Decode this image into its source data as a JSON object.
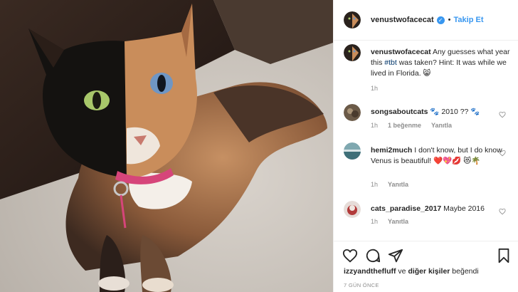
{
  "post": {
    "username": "venustwofacecat",
    "separator": "•",
    "follow_label": "Takip Et",
    "verified_glyph": "✓"
  },
  "caption": {
    "username": "venustwofacecat",
    "text_before_tag": " Any guesses what year this ",
    "hashtag": "#tbt",
    "text_after_tag": " was taken? Hint: It was while we lived in Florida. 😸",
    "time": "1h"
  },
  "comments": [
    {
      "username": "songsaboutcats",
      "text": " 🐾 2010 ?? 🐾",
      "time": "1h",
      "likes": "1 beğenme",
      "reply": "Yanıtla"
    },
    {
      "username": "hemi2much",
      "text": " I don't know, but I do know Venus is beautiful! ❤️💖💋 😻🌴",
      "time": "1h",
      "likes": "",
      "reply": "Yanıtla"
    },
    {
      "username": "cats_paradise_2017",
      "text": " Maybe 2016",
      "time": "1h",
      "likes": "",
      "reply": "Yanıtla"
    }
  ],
  "likes": {
    "user": "izzyandthefluff",
    "connector": " ve ",
    "others": "diğer kişiler",
    "suffix": " beğendi"
  },
  "date": "7 GÜN ÖNCE",
  "icons": [
    "heart-icon",
    "comment-icon",
    "share-icon",
    "bookmark-icon",
    "verified-icon"
  ],
  "colors": {
    "link": "#3897f0",
    "hashtag": "#003569",
    "muted": "#8e8e8e",
    "border": "#efefef"
  }
}
